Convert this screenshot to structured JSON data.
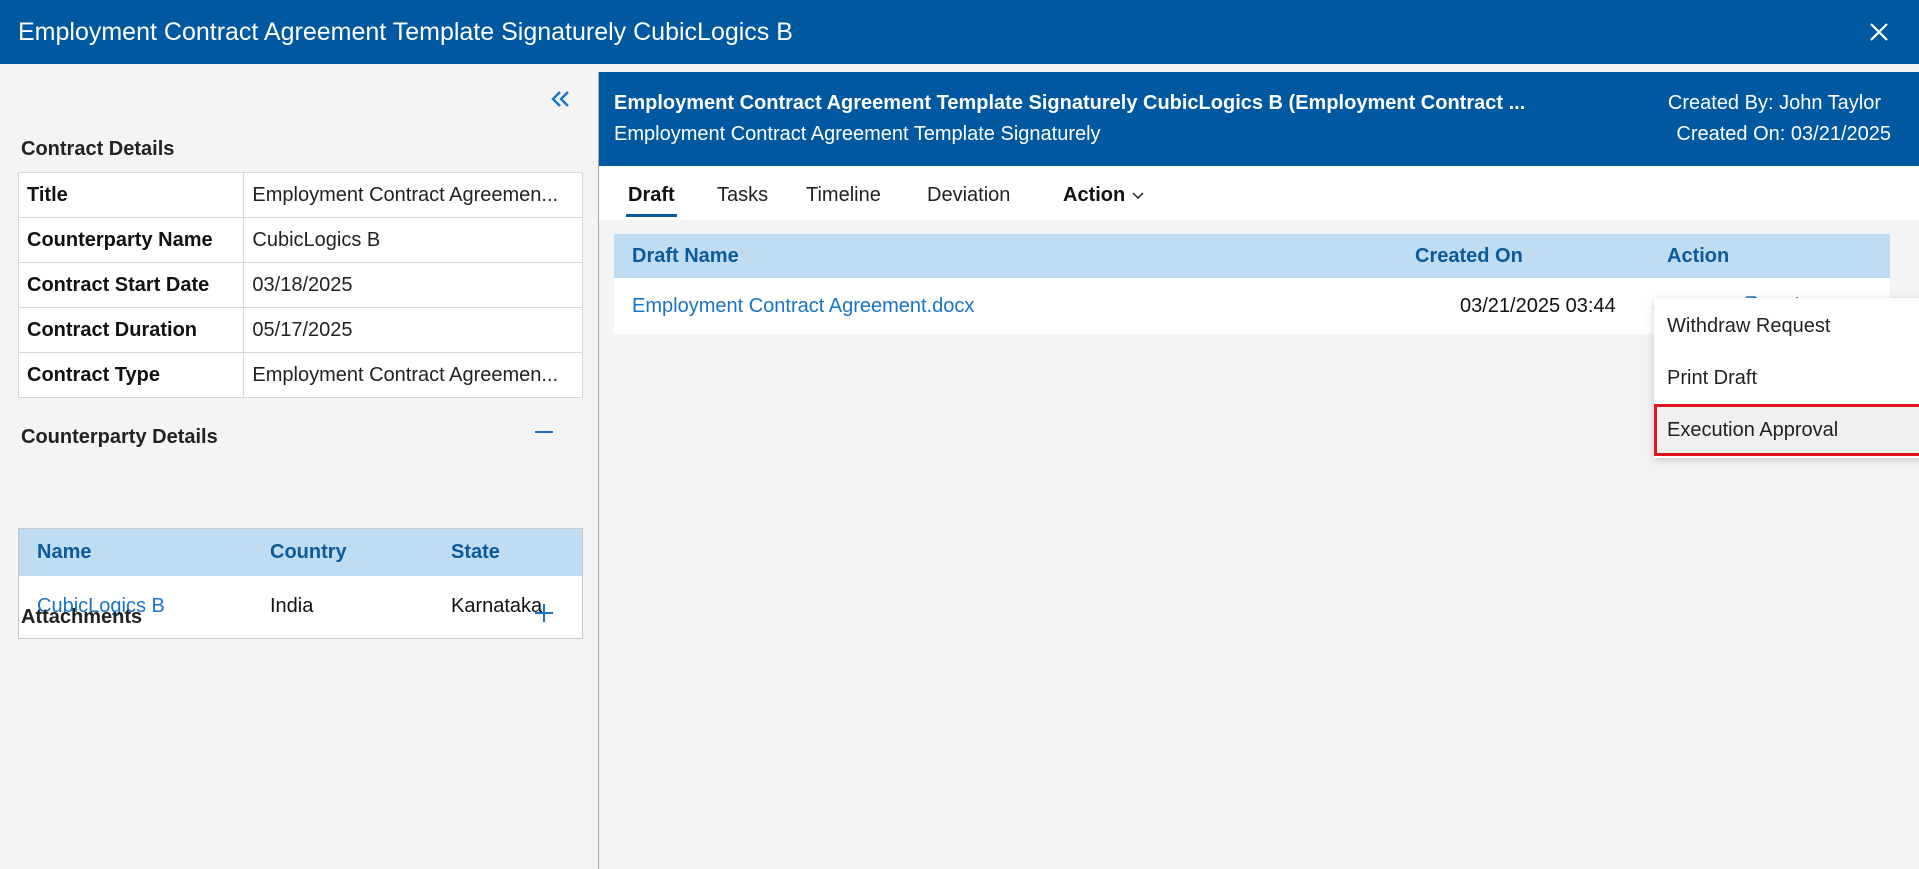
{
  "window": {
    "title": "Employment Contract Agreement Template Signaturely CubicLogics B"
  },
  "sidebar": {
    "contract_details_title": "Contract Details",
    "contract_details": [
      {
        "label": "Title",
        "value": "Employment Contract Agreemen..."
      },
      {
        "label": "Counterparty Name",
        "value": "CubicLogics B"
      },
      {
        "label": "Contract Start Date",
        "value": "03/18/2025"
      },
      {
        "label": "Contract Duration",
        "value": "05/17/2025"
      },
      {
        "label": "Contract Type",
        "value": "Employment Contract Agreemen..."
      }
    ],
    "counterparty_title": "Counterparty Details",
    "counterparty_columns": [
      "Name",
      "Country",
      "State"
    ],
    "counterparty_rows": [
      {
        "name": "CubicLogics B",
        "country": "India",
        "state": "Karnataka"
      }
    ],
    "attachments_title": "Attachments"
  },
  "header": {
    "title": "Employment Contract Agreement Template Signaturely CubicLogics B (Employment Contract ...",
    "subtitle": "Employment Contract Agreement Template Signaturely",
    "created_by_label": "Created By: ",
    "created_by": "John Taylor",
    "created_on_label": "Created On: ",
    "created_on": "03/21/2025"
  },
  "tabs": [
    {
      "label": "Draft",
      "active": true
    },
    {
      "label": "Tasks"
    },
    {
      "label": "Timeline"
    },
    {
      "label": "Deviation"
    }
  ],
  "action_tab_label": "Action",
  "draft_table": {
    "columns": {
      "draft_name": "Draft Name",
      "created_on": "Created On",
      "action": "Action"
    },
    "rows": [
      {
        "file": "Employment Contract Agreement.docx",
        "created_on": "03/21/2025 03:44"
      }
    ],
    "row_icons": [
      "eye-icon",
      "download-icon",
      "document-icon",
      "scale-icon"
    ]
  },
  "action_menu": [
    {
      "label": "Withdraw Request"
    },
    {
      "label": "Print Draft"
    },
    {
      "label": "Execution Approval",
      "highlighted": true
    }
  ],
  "colors": {
    "brand_blue": "#0058a1",
    "table_header_bg": "#c0dcf2",
    "link": "#1a73c6",
    "highlight_border": "#e0141e"
  }
}
